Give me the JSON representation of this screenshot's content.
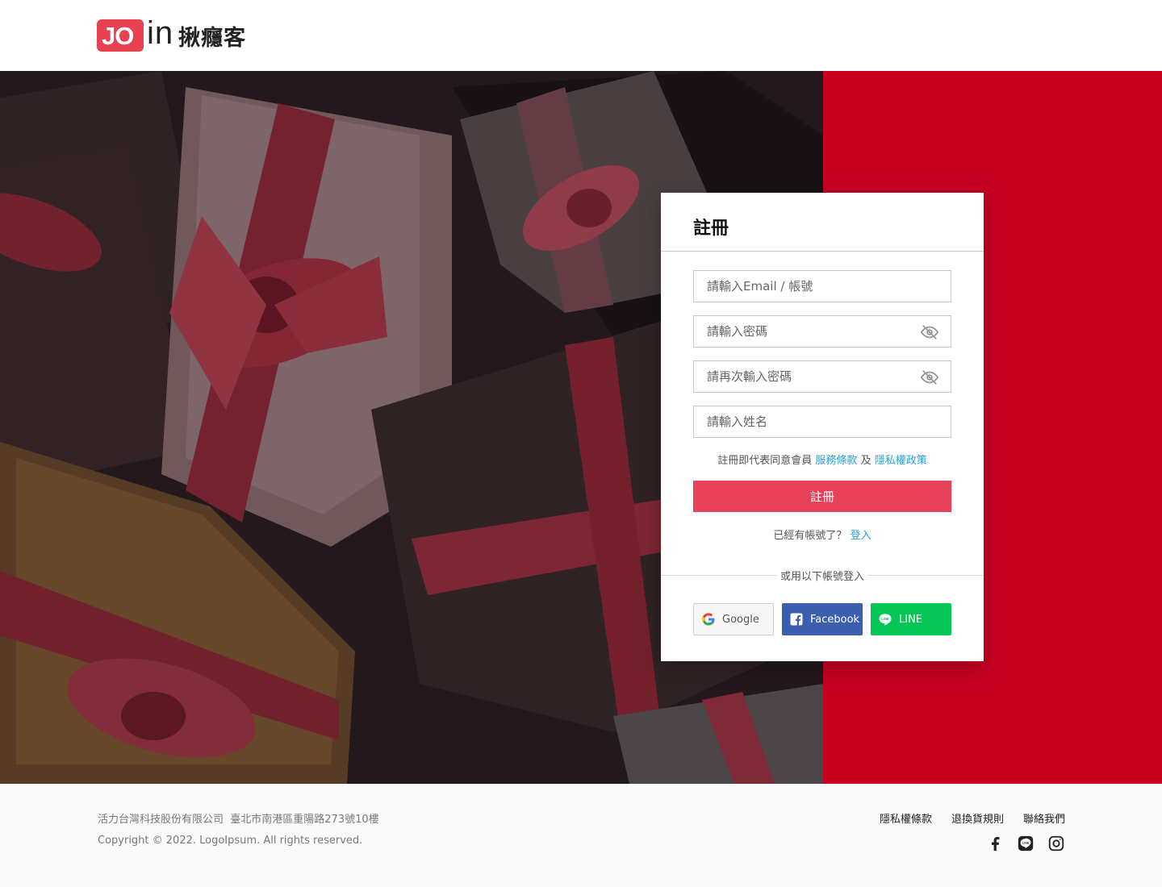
{
  "header": {
    "logo_jo": "JO",
    "logo_in": "in",
    "logo_text": "揪癮客"
  },
  "colors": {
    "brand_red": "#c70022",
    "button_red": "#e8415a",
    "link_blue": "#2a9fd0",
    "facebook": "#3b5fae",
    "line": "#06c755"
  },
  "register": {
    "title": "註冊",
    "email_placeholder": "請輸入Email / 帳號",
    "password_placeholder": "請輸入密碼",
    "confirm_password_placeholder": "請再次輸入密碼",
    "name_placeholder": "請輸入姓名",
    "terms_prefix": "註冊即代表同意會員",
    "terms_link": "服務條款",
    "terms_and": "及",
    "privacy_link": "隱私權政策",
    "submit_label": "註冊",
    "have_account": "已經有帳號了？",
    "login_link": "登入",
    "or_text": "或用以下帳號登入",
    "google_label": "Google",
    "facebook_label": "Facebook",
    "line_label": "LINE"
  },
  "footer": {
    "company": "活力台灣科技股份有限公司",
    "address": "臺北市南港區重陽路273號10樓",
    "copyright": "Copyright © 2022. LogoIpsum. All rights reserved.",
    "links": [
      "隱私權條款",
      "退換貨規則",
      "聯絡我們"
    ],
    "social_icons": [
      "facebook-icon",
      "line-icon",
      "instagram-icon"
    ]
  }
}
